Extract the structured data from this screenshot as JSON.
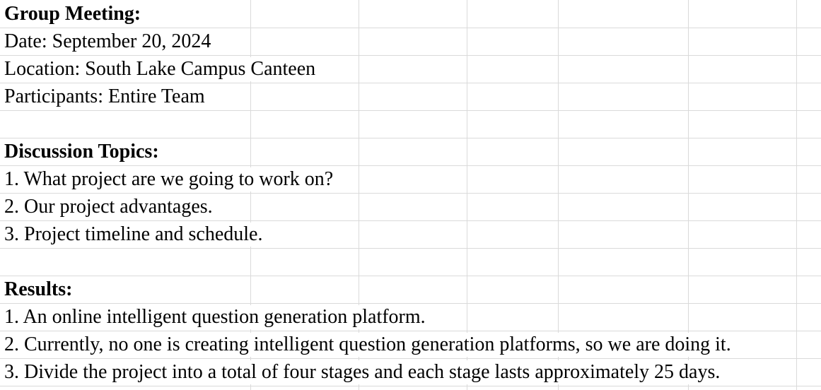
{
  "rows": [
    {
      "text": "Group Meeting:",
      "bold": true
    },
    {
      "text": "Date: September 20, 2024",
      "bold": false
    },
    {
      "text": "Location: South Lake Campus Canteen",
      "bold": false
    },
    {
      "text": "Participants: Entire Team",
      "bold": false
    },
    {
      "text": "",
      "bold": false
    },
    {
      "text": "Discussion Topics:",
      "bold": true
    },
    {
      "text": "1. What project are we going to work on?",
      "bold": false
    },
    {
      "text": "2. Our project advantages.",
      "bold": false
    },
    {
      "text": "3. Project timeline and schedule.",
      "bold": false
    },
    {
      "text": "",
      "bold": false
    },
    {
      "text": "Results:",
      "bold": true
    },
    {
      "text": "1. An online intelligent question generation platform.",
      "bold": false
    },
    {
      "text": "2. Currently, no one is creating intelligent question generation platforms, so we are doing it.",
      "bold": false
    },
    {
      "text": "3. Divide the project into a total of four stages and each stage lasts approximately 25 days.",
      "bold": false
    }
  ]
}
